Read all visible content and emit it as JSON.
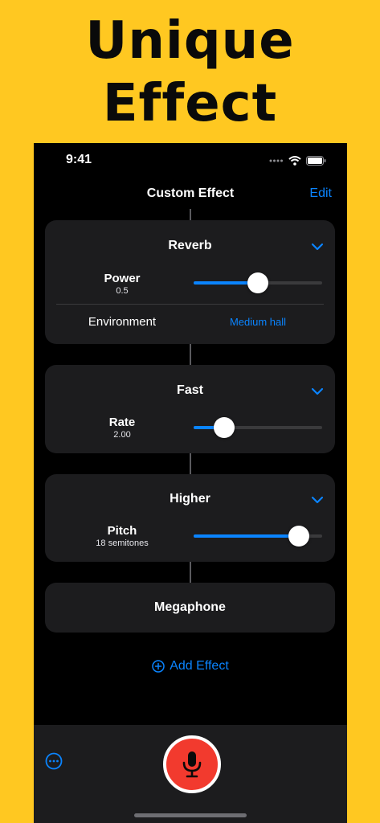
{
  "banner": {
    "line1": "Unique",
    "line2": "Effect"
  },
  "status_bar": {
    "time": "9:41"
  },
  "nav": {
    "title": "Custom Effect",
    "edit_label": "Edit"
  },
  "effects": [
    {
      "title": "Reverb",
      "param": {
        "label": "Power",
        "value": "0.5",
        "fraction": 0.5
      },
      "environment": {
        "label": "Environment",
        "value": "Medium hall"
      }
    },
    {
      "title": "Fast",
      "param": {
        "label": "Rate",
        "value": "2.00",
        "fraction": 0.24
      }
    },
    {
      "title": "Higher",
      "param": {
        "label": "Pitch",
        "value": "18 semitones",
        "fraction": 0.82
      }
    },
    {
      "title": "Megaphone"
    }
  ],
  "add_effect_label": "Add Effect",
  "colors": {
    "accent": "#0A84FF",
    "record": "#F23A2E",
    "background": "#FFC821"
  }
}
